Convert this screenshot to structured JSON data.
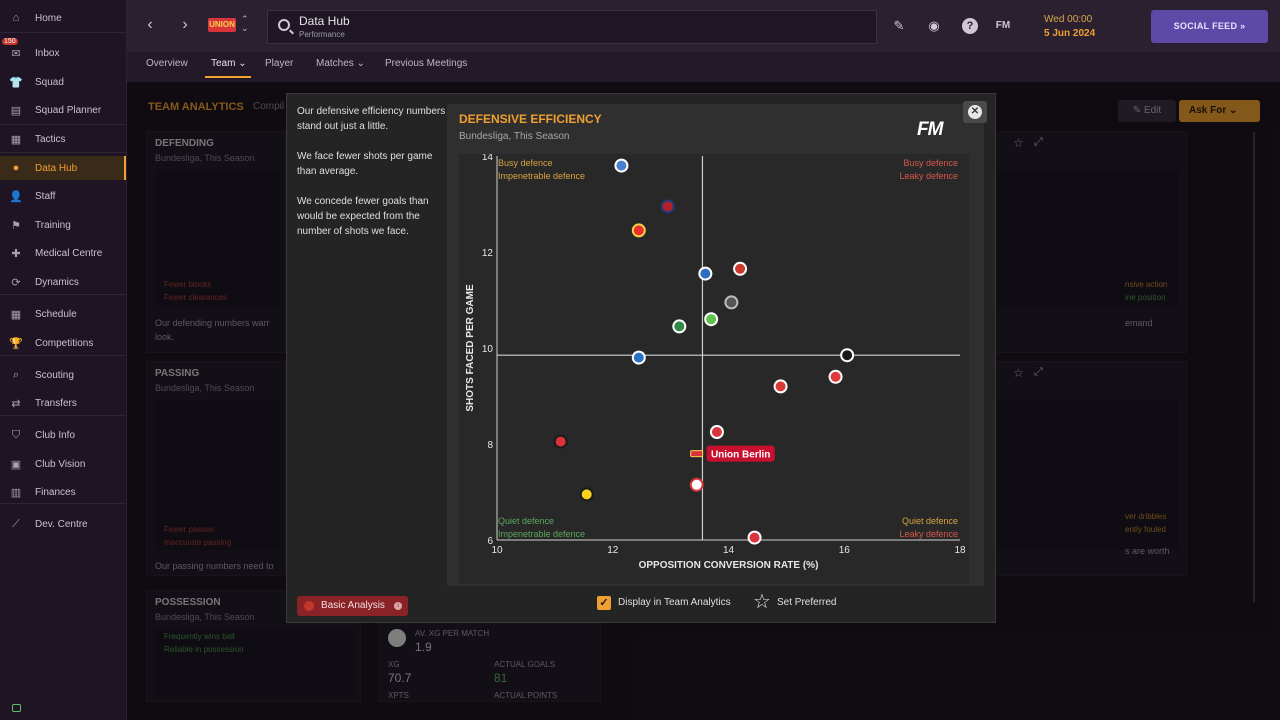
{
  "sidebar": {
    "inbox_badge": "150",
    "items": [
      {
        "label": "Home",
        "icon": "home-icon",
        "glyph": "⌂"
      },
      {
        "label": "Inbox",
        "icon": "inbox-icon",
        "glyph": "✉"
      },
      {
        "label": "Squad",
        "icon": "squad-icon",
        "glyph": "👕"
      },
      {
        "label": "Squad Planner",
        "icon": "squad-planner-icon",
        "glyph": "▤"
      },
      {
        "label": "Tactics",
        "icon": "tactics-icon",
        "glyph": "▦"
      },
      {
        "label": "Data Hub",
        "icon": "data-hub-icon",
        "glyph": "●"
      },
      {
        "label": "Staff",
        "icon": "staff-icon",
        "glyph": "👤"
      },
      {
        "label": "Training",
        "icon": "training-icon",
        "glyph": "⚑"
      },
      {
        "label": "Medical Centre",
        "icon": "medical-icon",
        "glyph": "✚"
      },
      {
        "label": "Dynamics",
        "icon": "dynamics-icon",
        "glyph": "⟳"
      },
      {
        "label": "Schedule",
        "icon": "schedule-icon",
        "glyph": "▦"
      },
      {
        "label": "Competitions",
        "icon": "trophy-icon",
        "glyph": "🏆"
      },
      {
        "label": "Scouting",
        "icon": "scouting-icon",
        "glyph": "⌕"
      },
      {
        "label": "Transfers",
        "icon": "transfers-icon",
        "glyph": "⇄"
      },
      {
        "label": "Club Info",
        "icon": "shield-icon",
        "glyph": "⛉"
      },
      {
        "label": "Club Vision",
        "icon": "briefcase-icon",
        "glyph": "▣"
      },
      {
        "label": "Finances",
        "icon": "finances-icon",
        "glyph": "▥"
      },
      {
        "label": "Dev. Centre",
        "icon": "dev-centre-icon",
        "glyph": "⟋"
      }
    ]
  },
  "topbar": {
    "back_glyph": "‹",
    "forward_glyph": "›",
    "club_badge": "UNION",
    "switch_glyph": "⌃⌄",
    "title": "Data Hub",
    "subtitle": "Performance",
    "date_day": "Wed 00:00",
    "date_date": "5 Jun 2024",
    "social_label": "SOCIAL FEED  »",
    "fm_small": "FM",
    "help_glyph": "?",
    "edit_glyph": "✎",
    "world_glyph": "◉"
  },
  "tabs": [
    {
      "label": "Overview"
    },
    {
      "label": "Team ⌄"
    },
    {
      "label": "Player"
    },
    {
      "label": "Matches ⌄"
    },
    {
      "label": "Previous Meetings"
    }
  ],
  "background": {
    "title": "TEAM ANALYTICS",
    "sub": "Compil",
    "edit_label": "✎ Edit",
    "askfor_label": "Ask For  ⌄",
    "defending": {
      "title": "DEFENDING",
      "sub": "Bundesliga, This Season",
      "lbl1": "Fewer blocks",
      "lbl2": "Fewer clearances",
      "text1": "Our defending numbers warr",
      "text2": "look."
    },
    "passing": {
      "title": "PASSING",
      "sub": "Bundesliga, This Season",
      "lbl1": "Fewer passes",
      "lbl2": "Inaccurate passing",
      "text1": "Our passing numbers need to"
    },
    "possession": {
      "title": "POSSESSION",
      "sub": "Bundesliga, This Season",
      "lbl1": "Frequently wins ball",
      "lbl2": "Reliable in possession"
    },
    "xg": {
      "title": "AV. XG PER MATCH",
      "value": "1.9",
      "xg_lbl": "XG",
      "xg_val": "70.7",
      "goals_lbl": "ACTUAL GOALS",
      "goals_val": "81",
      "xpts_lbl": "XPTS",
      "pts_lbl": "ACTUAL POINTS"
    },
    "right1": {
      "lbl1": "nsive action",
      "lbl2": "ine position",
      "text": "emand"
    },
    "right2": {
      "lbl1": "ver dribbles",
      "lbl2": "ently fouled",
      "text": "s are worth"
    }
  },
  "modal": {
    "desc": [
      "Our defensive efficiency numbers stand out just a little.",
      "We face fewer shots per game than average.",
      "We concede fewer goals than would be expected from the number of shots we face."
    ],
    "analysis_label": "Basic Analysis",
    "display_label": "Display in Team Analytics",
    "preferred_label": "Set Preferred",
    "close_glyph": "✕",
    "fm_logo": "FM"
  },
  "chart_data": {
    "type": "scatter",
    "title": "DEFENSIVE EFFICIENCY",
    "subtitle": "Bundesliga, This Season",
    "xlabel": "OPPOSITION CONVERSION RATE (%)",
    "ylabel": "SHOTS FACED PER GAME",
    "xlim": [
      10,
      18
    ],
    "ylim": [
      6,
      14
    ],
    "xticks": [
      10,
      12,
      14,
      16,
      18
    ],
    "yticks": [
      6,
      8,
      10,
      12,
      14
    ],
    "avg_x": 13.55,
    "avg_y": 9.85,
    "quadrants": {
      "top_left": [
        "Busy defence",
        "Impenetrable defence"
      ],
      "top_right": [
        "Busy defence",
        "Leaky defence"
      ],
      "bottom_left": [
        "Quiet defence",
        "Impenetrable defence"
      ],
      "bottom_right": [
        "Quiet defence",
        "Leaky defence"
      ]
    },
    "highlight_label": "Union Berlin",
    "colors": {
      "highlight": "#c8102e",
      "axis": "#cfcfcf",
      "busy_impenetrable": "#d9a441",
      "leaky": "#d9574a",
      "quiet": "#5aa85a"
    },
    "points": [
      {
        "x": 12.15,
        "y": 13.8,
        "fill": "#4a7fd1",
        "ring": "#ffffff"
      },
      {
        "x": 12.95,
        "y": 12.95,
        "fill": "#b3202a",
        "ring": "#1d3a7a"
      },
      {
        "x": 12.45,
        "y": 12.45,
        "fill": "#e8302e",
        "ring": "#f7d046"
      },
      {
        "x": 13.6,
        "y": 11.55,
        "fill": "#2f6ec0",
        "ring": "#ffffff"
      },
      {
        "x": 14.2,
        "y": 11.65,
        "fill": "#c93a2c",
        "ring": "#ffffff"
      },
      {
        "x": 14.05,
        "y": 10.95,
        "fill": "#555555",
        "ring": "#bbbbbb"
      },
      {
        "x": 13.15,
        "y": 10.45,
        "fill": "#2f8a4a",
        "ring": "#ffffff"
      },
      {
        "x": 13.7,
        "y": 10.6,
        "fill": "#5fc24a",
        "ring": "#ffffff"
      },
      {
        "x": 12.45,
        "y": 9.8,
        "fill": "#2a72c8",
        "ring": "#ffffff"
      },
      {
        "x": 16.05,
        "y": 9.85,
        "fill": "#1a1a1a",
        "ring": "#ffffff"
      },
      {
        "x": 15.85,
        "y": 9.4,
        "fill": "#e03a3a",
        "ring": "#ffffff"
      },
      {
        "x": 14.9,
        "y": 9.2,
        "fill": "#d83a3a",
        "ring": "#ffffff"
      },
      {
        "x": 13.8,
        "y": 8.25,
        "fill": "#d8343a",
        "ring": "#ffffff"
      },
      {
        "x": 13.45,
        "y": 7.8,
        "fill": "#d8343a",
        "ring": "#f5d24c",
        "highlight": true
      },
      {
        "x": 11.1,
        "y": 8.05,
        "fill": "#d8343a",
        "ring": "#1a1a1a"
      },
      {
        "x": 13.45,
        "y": 7.15,
        "fill": "#ffffff",
        "ring": "#d8343a"
      },
      {
        "x": 11.55,
        "y": 6.95,
        "fill": "#f6d21f",
        "ring": "#1a1a1a"
      },
      {
        "x": 14.45,
        "y": 6.05,
        "fill": "#d8343a",
        "ring": "#ffffff"
      }
    ]
  }
}
